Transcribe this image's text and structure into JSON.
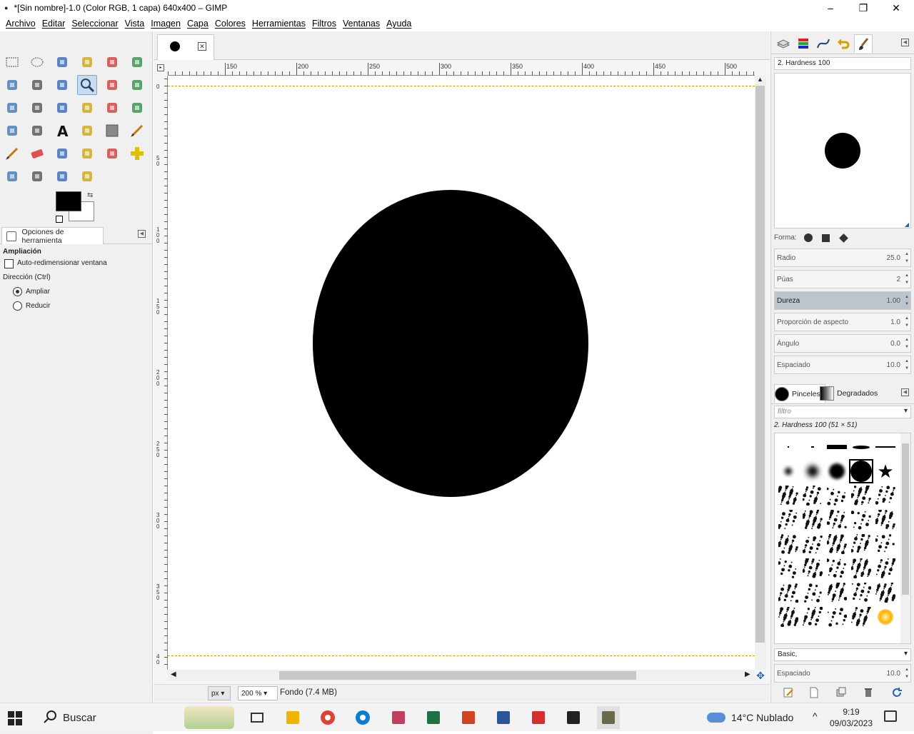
{
  "window": {
    "title": "*[Sin nombre]-1.0 (Color RGB, 1 capa) 640x400 – GIMP",
    "controls": {
      "minimize": "–",
      "maximize": "❐",
      "close": "✕"
    }
  },
  "menu": [
    "Archivo",
    "Editar",
    "Seleccionar",
    "Vista",
    "Imagen",
    "Capa",
    "Colores",
    "Herramientas",
    "Filtros",
    "Ventanas",
    "Ayuda"
  ],
  "toolbox": {
    "tools": [
      "rect-select-icon",
      "ellipse-select-icon",
      "free-select-icon",
      "fuzzy-select-icon",
      "select-by-color-icon",
      "scissors-icon",
      "foreground-select-icon",
      "paths-icon",
      "color-picker-icon",
      "zoom-icon",
      "measure-icon",
      "move-icon",
      "align-icon",
      "crop-icon",
      "rotate-icon",
      "scale-icon",
      "shear-icon",
      "perspective-icon",
      "flip-icon",
      "cage-icon",
      "text-icon",
      "bucket-fill-icon",
      "gradient-icon",
      "pencil-icon",
      "paintbrush-icon",
      "eraser-icon",
      "airbrush-icon",
      "ink-icon",
      "clone-icon",
      "heal-icon",
      "perspective-clone-icon",
      "blur-icon",
      "smudge-icon",
      "dodge-burn-icon"
    ],
    "selected_tool": "zoom-icon",
    "fg_color": "#000000",
    "bg_color": "#ffffff"
  },
  "tool_options": {
    "tab_label": "Opciones de herramienta",
    "heading": "Ampliación",
    "auto_resize_label": "Auto-redimensionar ventana",
    "auto_resize_checked": false,
    "direction_label": "Dirección (Ctrl)",
    "zoom_in_label": "Ampliar",
    "zoom_out_label": "Reducir",
    "direction_value": "Ampliar"
  },
  "ruler": {
    "h_labels": [
      "150",
      "200",
      "250",
      "300",
      "350",
      "400",
      "450",
      "500"
    ],
    "v_labels": [
      "0",
      "5\n0",
      "1\n0\n0",
      "1\n5\n0",
      "2\n0\n0",
      "2\n5\n0",
      "3\n0\n0",
      "3\n5\n0",
      "4\n0"
    ]
  },
  "status": {
    "unit": "px",
    "zoom": "200 %",
    "layer_info": "Fondo (7.4 MB)"
  },
  "brush_editor": {
    "name": "2. Hardness 100",
    "shape_label": "Forma:",
    "params": [
      {
        "label": "Radio",
        "value": "25.0",
        "highlight": false
      },
      {
        "label": "Púas",
        "value": "2",
        "highlight": false
      },
      {
        "label": "Dureza",
        "value": "1.00",
        "highlight": true
      },
      {
        "label": "Proporción de aspecto",
        "value": "1.0",
        "highlight": false
      },
      {
        "label": "Ángulo",
        "value": "0.0",
        "highlight": false
      },
      {
        "label": "Espaciado",
        "value": "10.0",
        "highlight": false
      }
    ]
  },
  "brushes_panel": {
    "tab_brushes": "Pinceles",
    "tab_gradients": "Degradados",
    "filter_placeholder": "filtro",
    "selected_brush": "2. Hardness 100 (51 × 51)",
    "tag_set": "Basic,",
    "spacing_label": "Espaciado",
    "spacing_value": "10.0"
  },
  "taskbar": {
    "search_label": "Buscar",
    "apps": [
      "task-view-icon",
      "file-explorer-icon",
      "chrome-icon",
      "edge-icon",
      "photos-icon",
      "excel-icon",
      "powerpoint-icon",
      "word-icon",
      "acrobat-icon",
      "inkscape-icon",
      "gimp-icon"
    ],
    "weather": "14°C  Nublado",
    "time": "9:19",
    "date": "09/03/2023"
  }
}
